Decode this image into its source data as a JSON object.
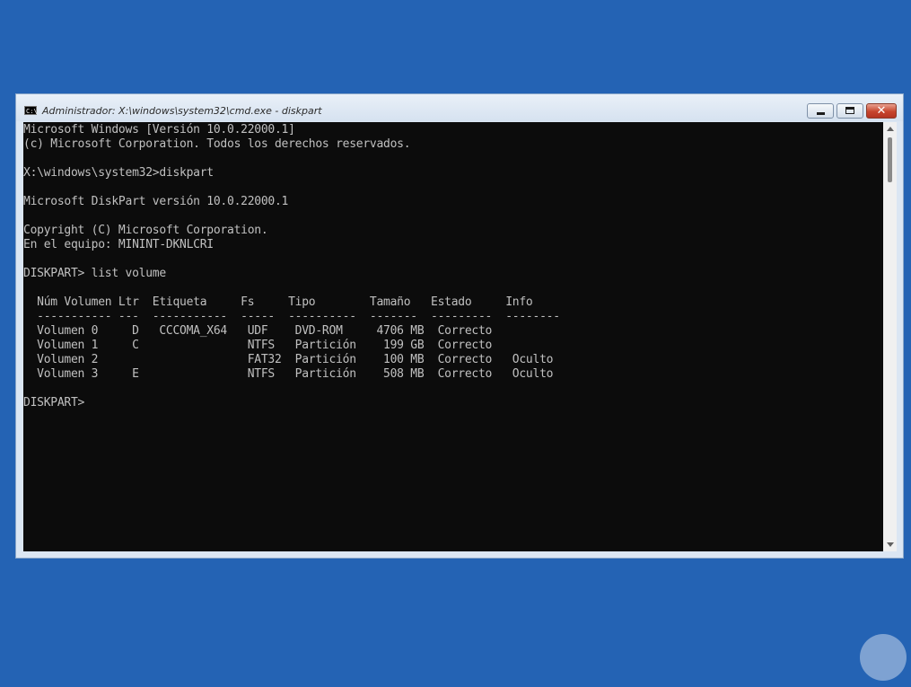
{
  "window": {
    "title": "Administrador: X:\\windows\\system32\\cmd.exe - diskpart",
    "close_glyph": "✕"
  },
  "console": {
    "lines": [
      "Microsoft Windows [Versión 10.0.22000.1]",
      "(c) Microsoft Corporation. Todos los derechos reservados.",
      "",
      "X:\\windows\\system32>diskpart",
      "",
      "Microsoft DiskPart versión 10.0.22000.1",
      "",
      "Copyright (C) Microsoft Corporation.",
      "En el equipo: MININT-DKNLCRI",
      "",
      "DISKPART> list volume",
      "",
      "  Núm Volumen Ltr  Etiqueta     Fs     Tipo        Tamaño   Estado     Info",
      "  ----------- ---  -----------  -----  ----------  -------  ---------  --------",
      "  Volumen 0     D   CCCOMA_X64   UDF    DVD-ROM     4706 MB  Correcto",
      "  Volumen 1     C                NTFS   Partición    199 GB  Correcto",
      "  Volumen 2                      FAT32  Partición    100 MB  Correcto   Oculto",
      "  Volumen 3     E                NTFS   Partición    508 MB  Correcto   Oculto",
      "",
      "DISKPART>"
    ]
  },
  "colors": {
    "desktop": "#2463b4",
    "console_bg": "#0c0c0c",
    "console_text": "#c0c0c0"
  },
  "icons": {
    "app": "cmd-icon",
    "minimize": "minimize-icon",
    "maximize": "maximize-icon",
    "close": "close-icon",
    "watermark": "watermark-logo"
  }
}
